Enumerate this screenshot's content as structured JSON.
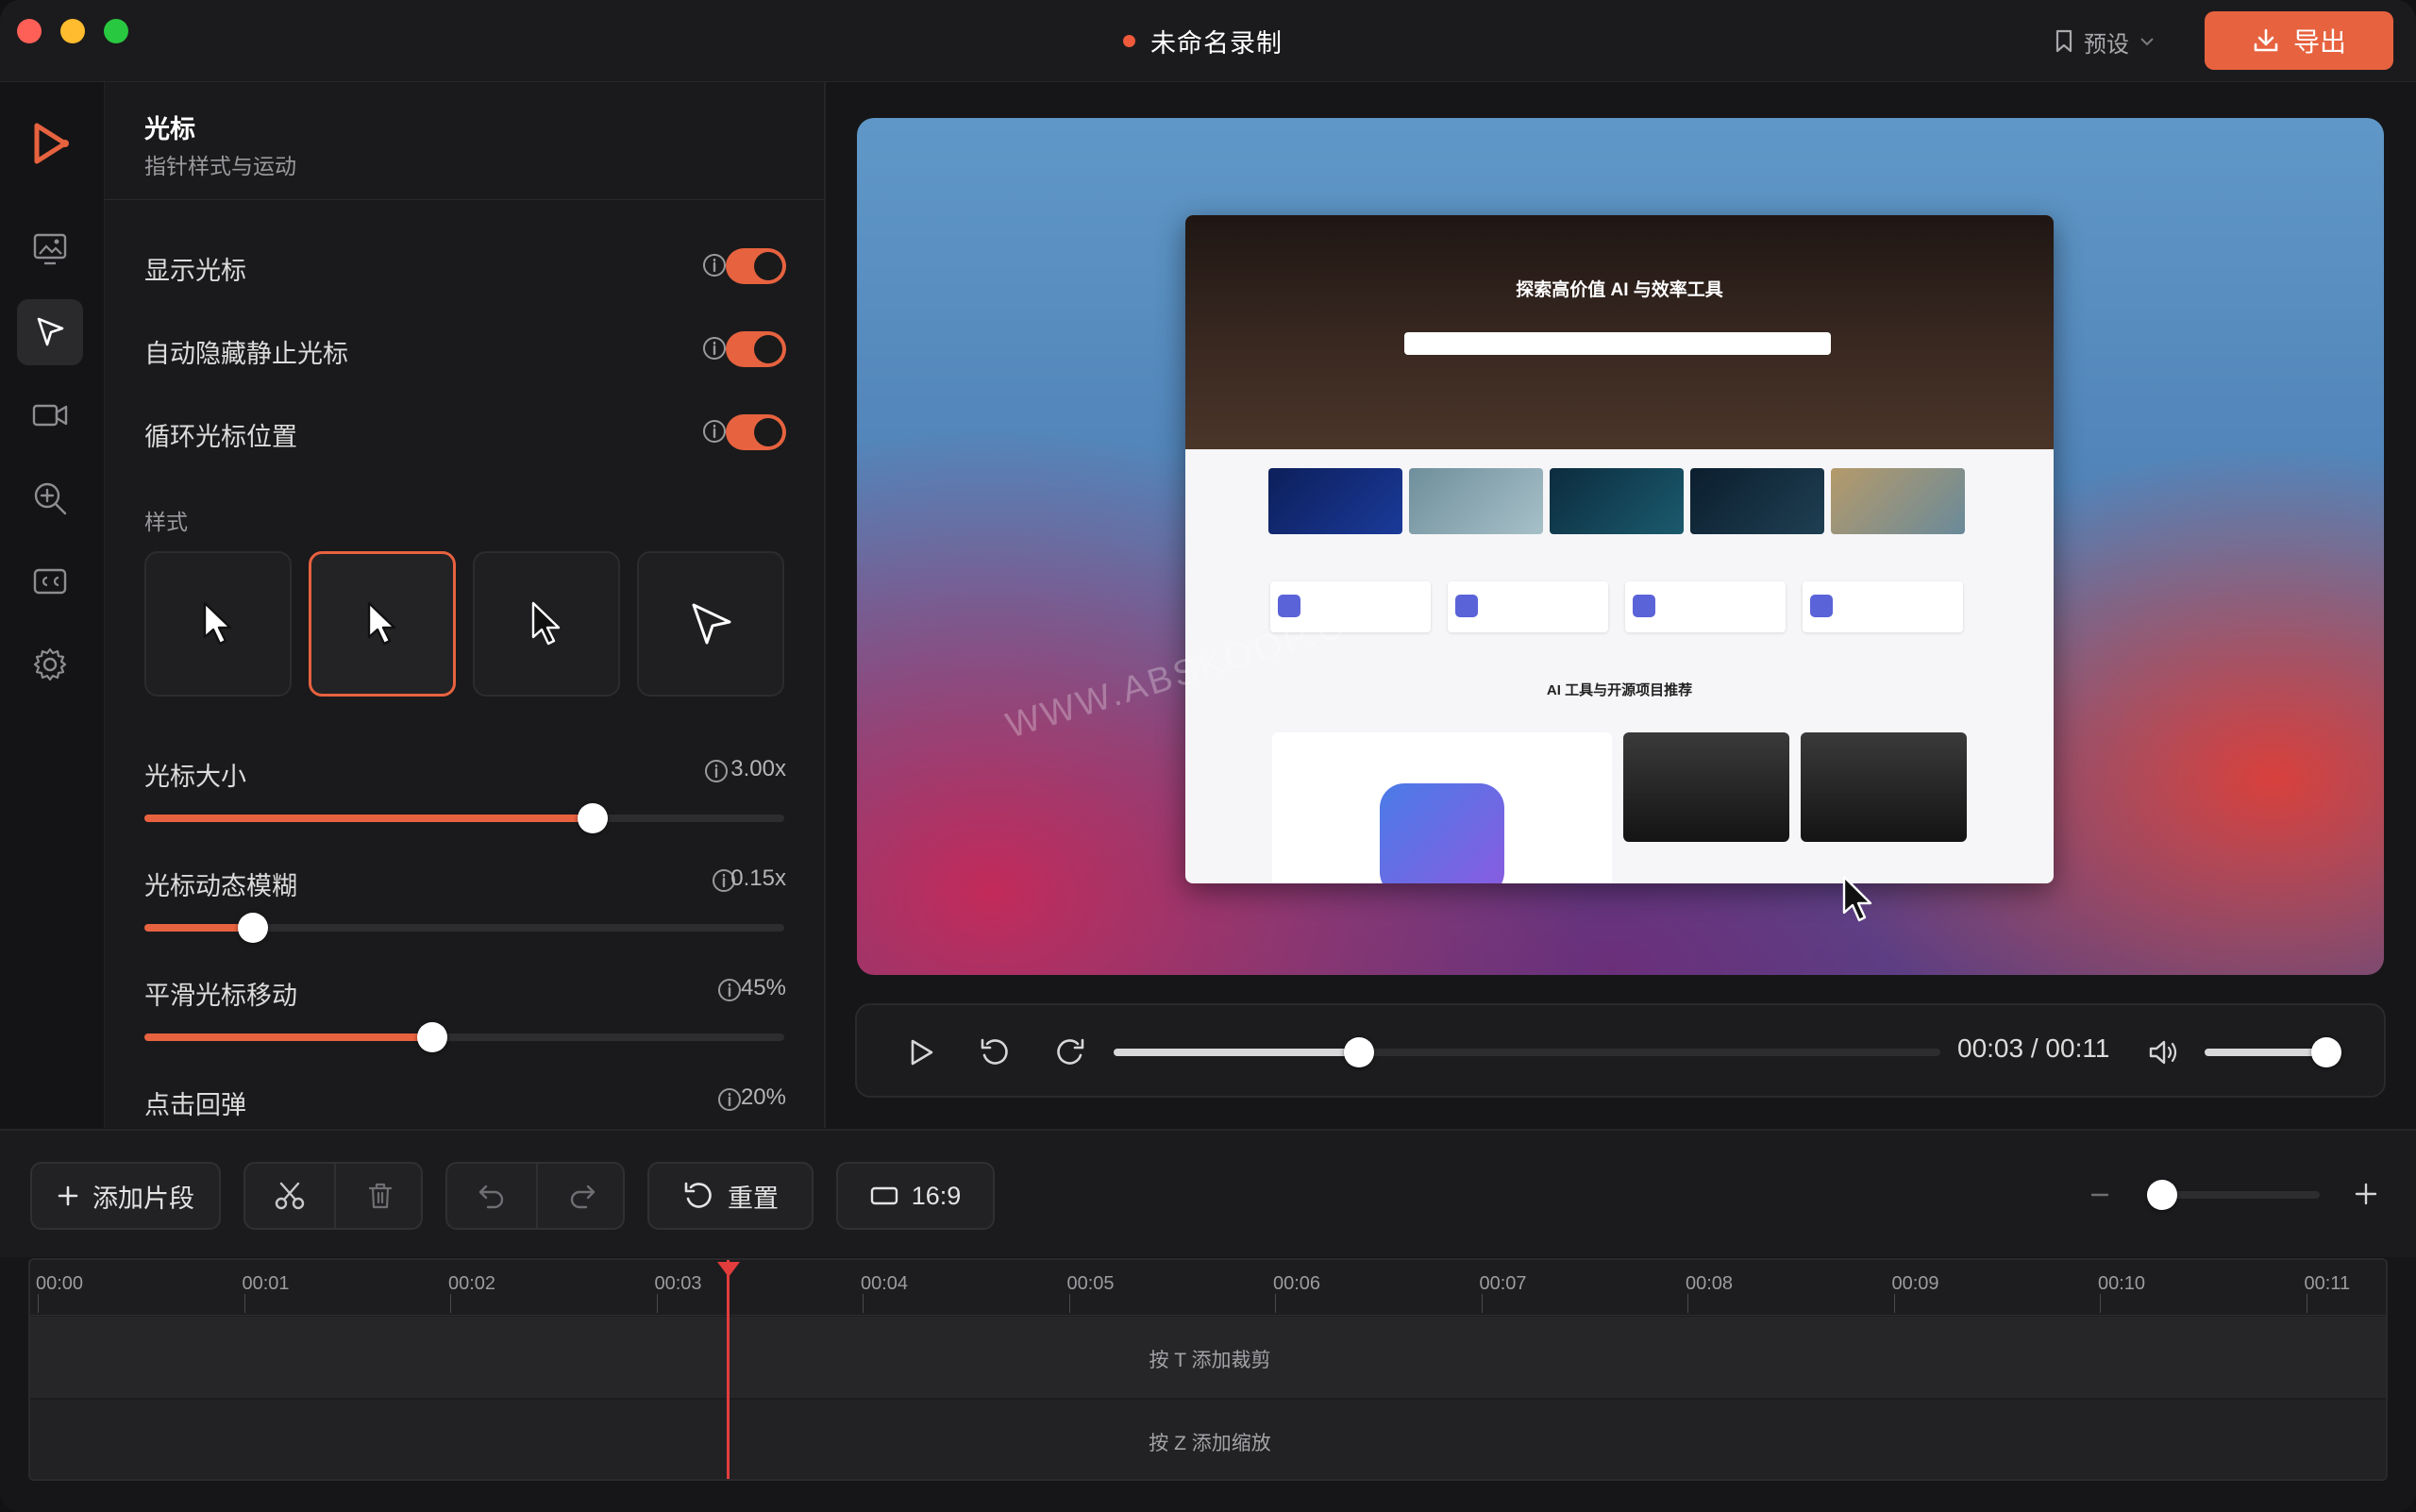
{
  "window": {
    "title": "未命名录制",
    "preset_label": "预设",
    "export_label": "导出"
  },
  "sidebar": {
    "items": [
      {
        "icon": "logo-play-icon"
      },
      {
        "icon": "screen-image-icon"
      },
      {
        "icon": "cursor-icon",
        "active": true
      },
      {
        "icon": "camera-icon"
      },
      {
        "icon": "zoom-icon"
      },
      {
        "icon": "captions-icon"
      },
      {
        "icon": "gear-icon"
      }
    ]
  },
  "panel": {
    "title": "光标",
    "subtitle": "指针样式与运动",
    "toggles": [
      {
        "label": "显示光标",
        "on": true
      },
      {
        "label": "自动隐藏静止光标",
        "on": true
      },
      {
        "label": "循环光标位置",
        "on": true
      }
    ],
    "style_label": "样式",
    "selected_style_index": 1,
    "sliders": [
      {
        "label": "光标大小",
        "value": "3.00x",
        "fraction": 0.7
      },
      {
        "label": "光标动态模糊",
        "value": "0.15x",
        "fraction": 0.17
      },
      {
        "label": "平滑光标移动",
        "value": "45%",
        "fraction": 0.45
      },
      {
        "label": "点击回弹",
        "value": "20%",
        "fraction": 0.2
      }
    ]
  },
  "preview": {
    "hero_title": "探索高价值 AI 与效率工具",
    "section_title": "AI 工具与开源项目推荐",
    "watermark": "WWW.ABSKOOP.COM"
  },
  "player": {
    "current_time": "00:03",
    "total_time": "00:11",
    "progress_fraction": 0.297,
    "volume_fraction": 0.92
  },
  "toolbar": {
    "add_clip_label": "添加片段",
    "reset_label": "重置",
    "aspect_label": "16:9",
    "zoom_fraction": 0.05
  },
  "timeline": {
    "ticks": [
      "00:00",
      "00:01",
      "00:02",
      "00:03",
      "00:04",
      "00:05",
      "00:06",
      "00:07",
      "00:08",
      "00:09",
      "00:10",
      "00:11"
    ],
    "track1_hint": "按 T 添加裁剪",
    "track2_hint": "按 Z 添加缩放",
    "playhead_time": "00:03"
  },
  "colors": {
    "accent": "#e7623f",
    "background": "#161618",
    "playhead": "#e23c3c"
  }
}
